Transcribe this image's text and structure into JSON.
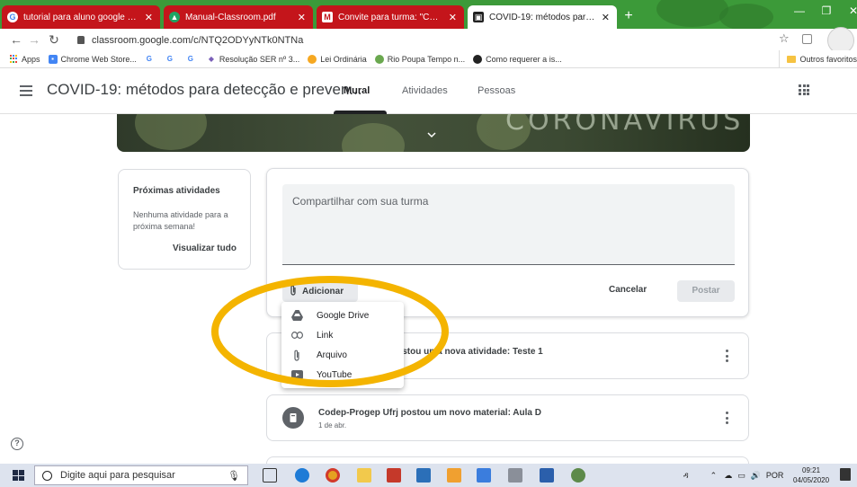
{
  "browser": {
    "tabs": [
      {
        "label": "tutorial para aluno google classr",
        "active": false,
        "icon": "google-icon"
      },
      {
        "label": "Manual-Classroom.pdf",
        "active": false,
        "icon": "drive-icon"
      },
      {
        "label": "Convite para turma: \"COVID-19: ",
        "active": false,
        "icon": "gmail-icon"
      },
      {
        "label": "COVID-19: métodos para detecç",
        "active": true,
        "icon": "classroom-icon"
      }
    ],
    "new_tab": "+",
    "url": "classroom.google.com/c/NTQ2ODYyNTk0NTNa",
    "bookmarks": [
      {
        "label": "Apps",
        "icon": "apps-icon",
        "color": "#e8453c"
      },
      {
        "label": "Chrome Web Store...",
        "icon": "webstore-icon",
        "color": "#4285f4"
      },
      {
        "label": "",
        "icon": "google-icon",
        "color": "#4285f4"
      },
      {
        "label": "",
        "icon": "google-icon",
        "color": "#4285f4"
      },
      {
        "label": "",
        "icon": "google-icon",
        "color": "#4285f4"
      },
      {
        "label": "Resolução SER nº 3...",
        "icon": "bookmark-icon",
        "color": "#7a5fb8"
      },
      {
        "label": "Lei Ordinária",
        "icon": "bookmark-icon",
        "color": "#f6a821"
      },
      {
        "label": "Rio Poupa Tempo n...",
        "icon": "bookmark-icon",
        "color": "#6aa84f"
      },
      {
        "label": "Como requerer a is...",
        "icon": "bookmark-icon",
        "color": "#222222"
      }
    ],
    "other_bookmarks": "Outros favoritos"
  },
  "classroom": {
    "title": "COVID-19: métodos para detecção e preven...",
    "nav_tabs": [
      "Mural",
      "Atividades",
      "Pessoas"
    ],
    "banner_text": "CORONAVIRUS",
    "upcoming": {
      "title": "Próximas atividades",
      "description": "Nenhuma atividade para a próxima semana!",
      "view_all": "Visualizar tudo"
    },
    "share": {
      "placeholder": "Compartilhar com sua turma",
      "add_label": "Adicionar",
      "cancel_label": "Cancelar",
      "post_label": "Postar"
    },
    "add_menu": [
      {
        "label": "Google Drive",
        "icon": "drive-icon"
      },
      {
        "label": "Link",
        "icon": "link-icon"
      },
      {
        "label": "Arquivo",
        "icon": "attachment-icon"
      },
      {
        "label": "YouTube",
        "icon": "youtube-icon"
      }
    ],
    "stream": [
      {
        "text": "postou uma nova atividade: Teste 1",
        "date": ""
      },
      {
        "text": "Codep-Progep Ufrj postou um novo material: Aula D",
        "date": "1 de abr."
      }
    ]
  },
  "taskbar": {
    "search_placeholder": "Digite aqui para pesquisar",
    "language": "POR",
    "time": "09:21",
    "date": "04/05/2020"
  },
  "colors": {
    "tab_strip": "#3c9a39",
    "inactive_tab": "#c4151b",
    "annotation": "#f4b400"
  }
}
